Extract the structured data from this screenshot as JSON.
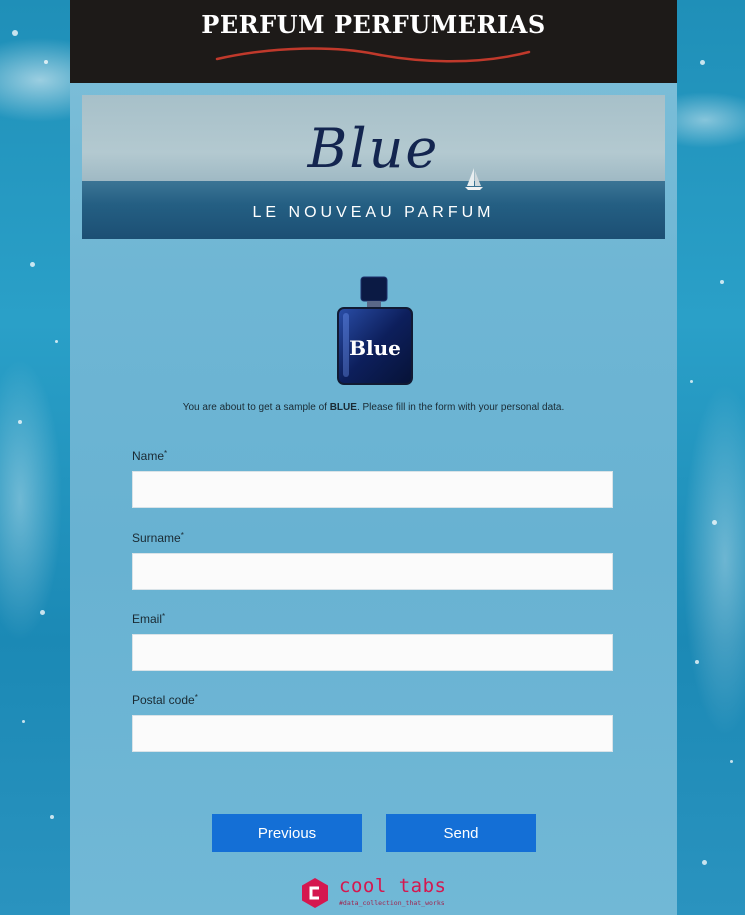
{
  "header": {
    "brand": "PERFUM PERFUMERIAS"
  },
  "banner": {
    "title": "Blue",
    "subtitle": "LE NOUVEAU PARFUM"
  },
  "product": {
    "bottle_label": "Blue"
  },
  "intro": {
    "before": "You are about to get a sample of ",
    "highlight": "BLUE",
    "after": ". Please fill in the form with your personal data."
  },
  "form": {
    "required_mark": "*",
    "fields": [
      {
        "label": "Name",
        "value": ""
      },
      {
        "label": "Surname",
        "value": ""
      },
      {
        "label": "Email",
        "value": ""
      },
      {
        "label": "Postal code",
        "value": ""
      }
    ]
  },
  "buttons": {
    "previous": "Previous",
    "send": "Send"
  },
  "footer": {
    "name": "cool tabs",
    "tagline": "#data_collection_that_works"
  },
  "colors": {
    "accent": "#146fd6",
    "brand_dark": "#1d1a18",
    "footer_brand": "#d5174f",
    "swoosh": "#c0392b"
  }
}
